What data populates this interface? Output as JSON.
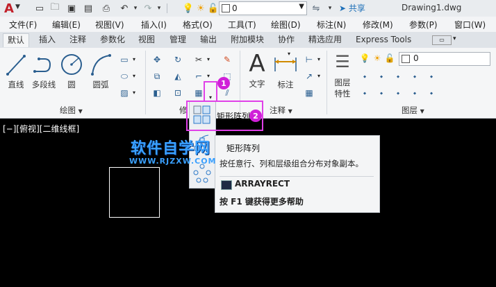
{
  "app": {
    "logo_letter": "A",
    "doc_title": "Drawing1.dwg",
    "share_label": "共享",
    "layer_combo_value": "0"
  },
  "menu": [
    "文件(F)",
    "编辑(E)",
    "视图(V)",
    "插入(I)",
    "格式(O)",
    "工具(T)",
    "绘图(D)",
    "标注(N)",
    "修改(M)",
    "参数(P)",
    "窗口(W)"
  ],
  "tabs": [
    "默认",
    "插入",
    "注释",
    "参数化",
    "视图",
    "管理",
    "输出",
    "附加模块",
    "协作",
    "精选应用",
    "Express Tools"
  ],
  "ribbon": {
    "draw_tools": [
      {
        "label": "直线",
        "icon": "line-icon"
      },
      {
        "label": "多段线",
        "icon": "polyline-icon"
      },
      {
        "label": "圆",
        "icon": "circle-icon"
      },
      {
        "label": "圆弧",
        "icon": "arc-icon"
      }
    ],
    "draw_panel_label": "绘图",
    "modify_panel_label": "修",
    "annotation_tools": [
      {
        "label": "文字",
        "icon": "text-icon"
      },
      {
        "label": "标注",
        "icon": "dimension-icon"
      }
    ],
    "annotation_panel_label": "注释",
    "layer_prop_label_1": "图层",
    "layer_prop_label_2": "特性",
    "layer_panel_label": "图层",
    "layer_value": "0"
  },
  "viewport_label": "[−][俯视][二维线框]",
  "flyout": {
    "item_label": "矩形阵列"
  },
  "tooltip": {
    "title": "矩形阵列",
    "description": "按任意行、列和层级组合分布对象副本。",
    "command": "ARRAYRECT",
    "help": "按 F1 键获得更多帮助"
  },
  "badges": [
    "1",
    "2"
  ],
  "watermark": {
    "main": "软件自学网",
    "sub": "WWW.RJZXW.COM"
  },
  "colors": {
    "highlight": "#e040e8",
    "accent": "#2a5e8f",
    "share": "#1d6fb8",
    "watermark": "#3aa0ff"
  }
}
